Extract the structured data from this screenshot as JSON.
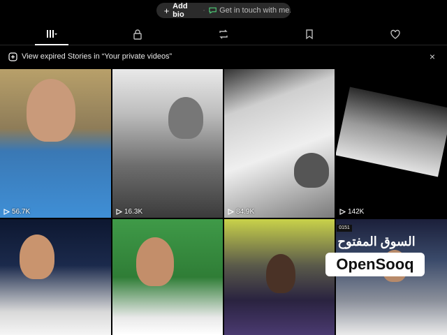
{
  "bio": {
    "add_label": "Add bio",
    "separator": "·",
    "get_in_touch": "Get in touch with me..."
  },
  "tabs": [
    {
      "icon": "grid-menu-icon",
      "active": true
    },
    {
      "icon": "lock-icon"
    },
    {
      "icon": "repost-icon"
    },
    {
      "icon": "bookmark-icon"
    },
    {
      "icon": "heart-icon"
    }
  ],
  "banner": {
    "text": "View expired Stories in “Your private videos”",
    "close": "×"
  },
  "videos": [
    {
      "views": "56.7K"
    },
    {
      "views": "16.3K"
    },
    {
      "views": "84.9K"
    },
    {
      "views": "142K"
    },
    {
      "views": ""
    },
    {
      "views": ""
    },
    {
      "views": ""
    },
    {
      "views": ""
    }
  ],
  "watermark": {
    "arabic": "السوق المفتوح",
    "latin": "OpenSooq"
  },
  "tag": "0151"
}
